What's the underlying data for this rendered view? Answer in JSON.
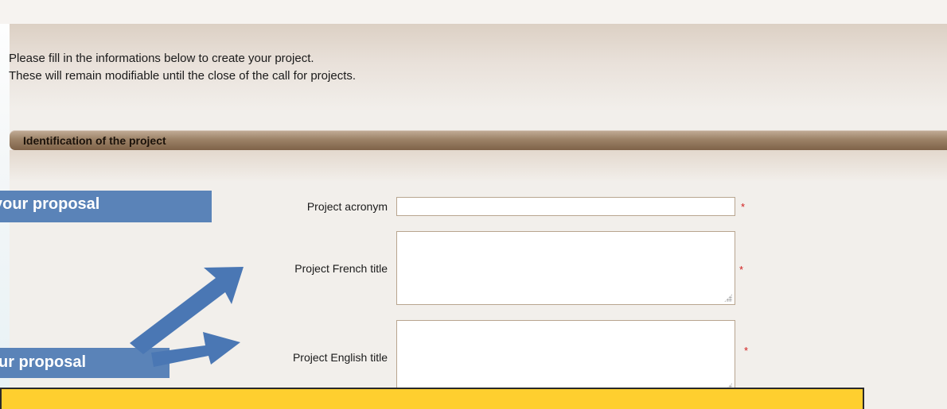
{
  "intro": {
    "line1": "Please fill in the informations below to create your project.",
    "line2": "These will remain modifiable until the close of the call for projects."
  },
  "section": {
    "title": "Identification of the project"
  },
  "fields": {
    "acronym": {
      "label": "Project acronym",
      "value": "",
      "required_mark": "*"
    },
    "french_title": {
      "label": "Project French title",
      "value": "",
      "required_mark": "*"
    },
    "english_title": {
      "label": "Project English title",
      "value": "",
      "required_mark": "*"
    }
  },
  "callouts": {
    "first": "your proposal",
    "second": "ur proposal"
  },
  "colors": {
    "panel_bg": "#f2efeb",
    "section_header": "#9d8368",
    "input_border": "#b8a58f",
    "required_star": "#d11b1b",
    "callout_bg": "#5a83b8",
    "arrow": "#4a77b4",
    "note_bg": "#fecf2f"
  }
}
